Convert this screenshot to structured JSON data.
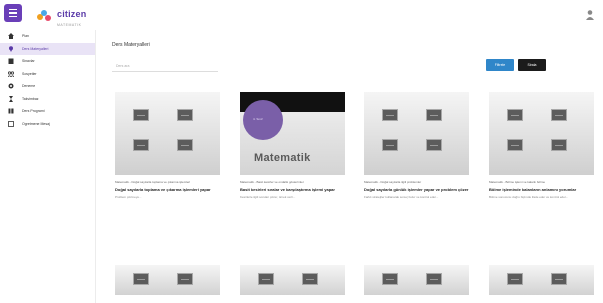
{
  "app": {
    "logo_text": "citizen",
    "logo_sub": "MATEMATIK"
  },
  "sidebar": {
    "items": [
      {
        "label": "Plan",
        "icon": "home-icon"
      },
      {
        "label": "Ders Materyalleri",
        "icon": "pin-icon",
        "active": true
      },
      {
        "label": "Sinavlar",
        "icon": "clipboard-icon"
      },
      {
        "label": "Sosyetler",
        "icon": "group-icon"
      },
      {
        "label": "Deneme",
        "icon": "gear-icon"
      },
      {
        "label": "Takvimbaz",
        "icon": "hourglass-icon"
      },
      {
        "label": "Ders Programi",
        "icon": "book-icon"
      },
      {
        "label": "Ogretmene Mesaj",
        "icon": "message-icon"
      }
    ]
  },
  "main": {
    "title": "Ders Materyalleri",
    "search_placeholder": "Ders ara",
    "filter_button": "Filtrele",
    "sort_button": "Sirala"
  },
  "cards": [
    {
      "meta": "Matematik - Doğal sayılarla toplama ve çıkarma işlemleri",
      "title": "Doğal sayılarla toplama ve çıkarma işlemleri yapar",
      "desc": "Problem çözmeye..."
    },
    {
      "meta": "Matematik - Basit kesirler ve ondalık gösterimler",
      "title": "Basit kesirleri sıralar ve karşılaştırma işlemi yapar",
      "desc": "Kesirlerle ilgili soruları çözer, örnek verir..."
    },
    {
      "meta": "Matematik - Doğal sayılarla ilgili problemler",
      "title": "Doğal sayılarla günlük işlemler yapar ve problem çözer",
      "desc": "Farklı stratejiler kullanarak sonuç bulur ve kontrol eder..."
    },
    {
      "meta": "Matematik - Bölme işlemi ve kalanlı bölme",
      "title": "Bölme işleminde kalanların anlamını yorumlar",
      "desc": "Bölme sonucunu doğru biçimde ifade eder ve kontrol eder..."
    }
  ],
  "math_card": {
    "circle_label": "4. Sınıf",
    "word": "Matematik"
  }
}
